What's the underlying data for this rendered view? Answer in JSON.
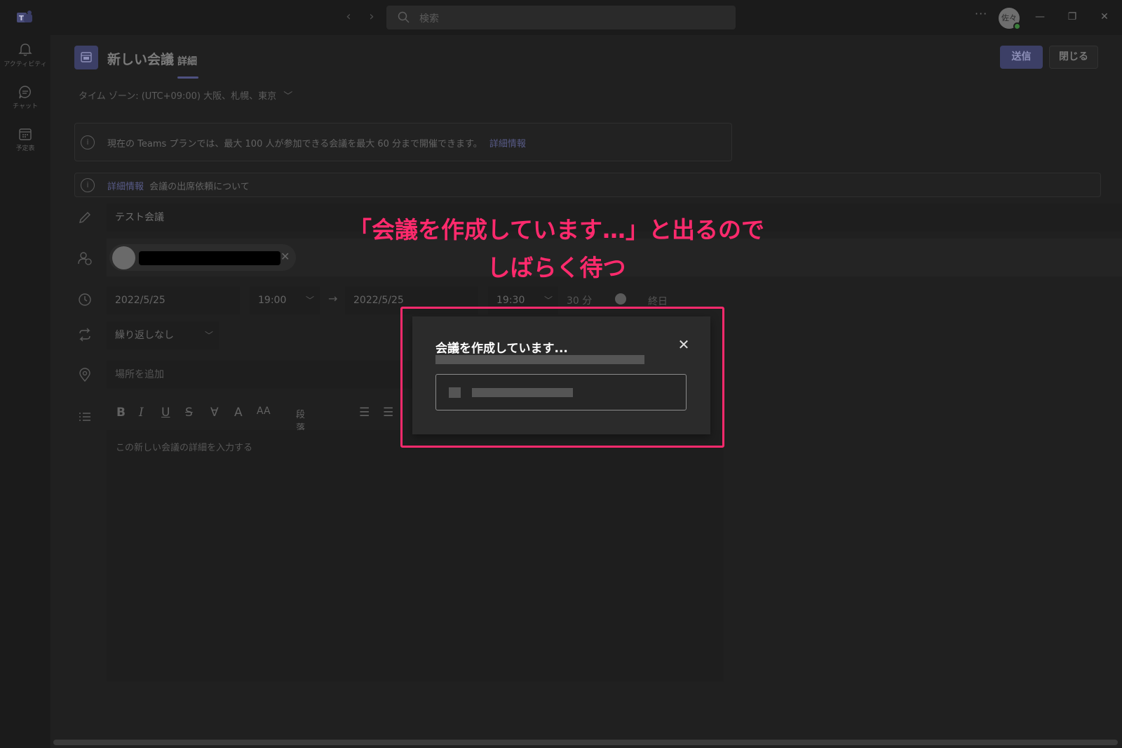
{
  "titlebar": {
    "search_placeholder": "検索",
    "more": "···",
    "avatar_initials": "佐々"
  },
  "rail": {
    "items": [
      {
        "label": "アクティビティ",
        "icon": "bell-icon"
      },
      {
        "label": "チャット",
        "icon": "chat-icon"
      },
      {
        "label": "予定表",
        "icon": "calendar-icon"
      }
    ]
  },
  "header": {
    "title": "新しい会議",
    "tab_details": "詳細",
    "send_label": "送信",
    "close_label": "閉じる"
  },
  "timezone": "タイム ゾーン: (UTC+09:00) 大阪、札幌、東京",
  "banners": {
    "plan_text": "現在の Teams プランでは、最大 100 人が参加できる会議を最大 60 分まで開催できます。",
    "plan_link": "詳細情報",
    "attendance_link": "詳細情報",
    "attendance_text": "会議の出席依頼について"
  },
  "form": {
    "meeting_title": "テスト会議",
    "start_date": "2022/5/25",
    "start_time": "19:00",
    "end_date": "2022/5/25",
    "end_time": "19:30",
    "duration": "30 分",
    "all_day": "終日",
    "repeat": "繰り返しなし",
    "location_placeholder": "場所を追加",
    "paragraph": "段落",
    "editor_placeholder": "この新しい会議の詳細を入力する"
  },
  "annotation": {
    "line1": "「会議を作成しています…」と出るので",
    "line2": "しばらく待つ"
  },
  "dialog": {
    "title": "会議を作成しています..."
  },
  "colors": {
    "accent": "#ff2a6d",
    "brand": "#3c3f66"
  }
}
